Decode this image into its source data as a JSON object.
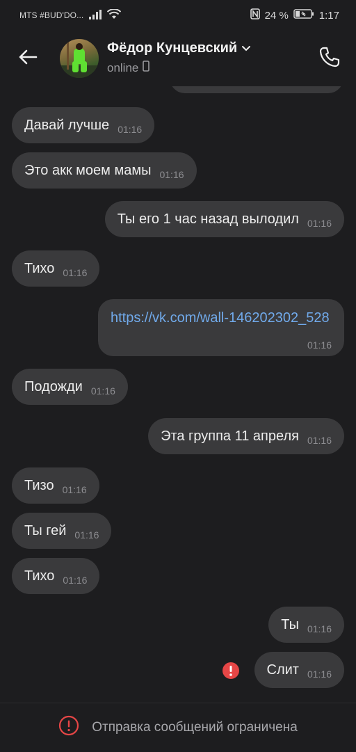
{
  "status_bar": {
    "carrier": "MTS #BUD'DO...",
    "battery": "24 %",
    "time": "1:17"
  },
  "header": {
    "contact_name": "Фёдор Кунцевский",
    "presence": "online"
  },
  "messages": [
    {
      "side": "in",
      "text": "Давай лучше",
      "time": "01:16"
    },
    {
      "side": "in",
      "text": "Это акк моем мамы",
      "time": "01:16"
    },
    {
      "side": "out",
      "text": "Ты его 1 час назад выло­дил",
      "time": "01:16"
    },
    {
      "side": "in",
      "text": "Тихо",
      "time": "01:16"
    },
    {
      "side": "out",
      "text": "https://vk.com/wall-146202302_528",
      "time": "01:16"
    },
    {
      "side": "in",
      "text": "Подожди",
      "time": "01:16"
    },
    {
      "side": "out",
      "text": "Эта группа 11 апреля",
      "time": "01:16"
    },
    {
      "side": "in",
      "text": "Тизо",
      "time": "01:16"
    },
    {
      "side": "in",
      "text": "Ты гей",
      "time": "01:16"
    },
    {
      "side": "in",
      "text": "Тихо",
      "time": "01:16"
    },
    {
      "side": "out",
      "text": "Ты",
      "time": "01:16"
    },
    {
      "side": "out",
      "text": "Слит",
      "time": "01:16",
      "status": "error"
    }
  ],
  "footer": {
    "notice": "Отправка сообщений ограничена"
  },
  "colors": {
    "background": "#1d1d1f",
    "bubble": "#3a3a3c",
    "link": "#71aaeb",
    "error": "#e64646"
  }
}
